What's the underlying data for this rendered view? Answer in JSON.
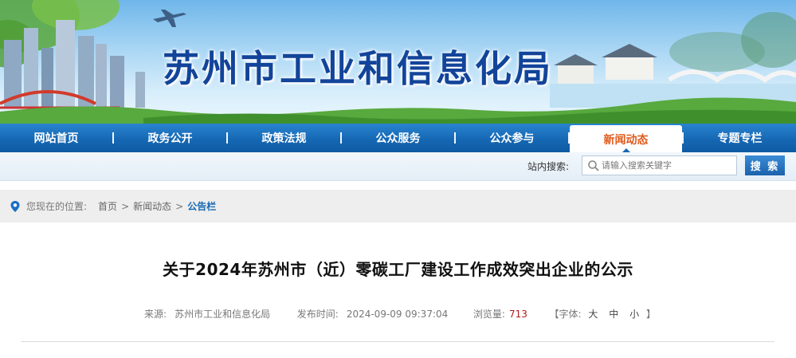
{
  "site": {
    "title": "苏州市工业和信息化局"
  },
  "nav": {
    "items": [
      {
        "label": "网站首页"
      },
      {
        "label": "政务公开"
      },
      {
        "label": "政策法规"
      },
      {
        "label": "公众服务"
      },
      {
        "label": "公众参与"
      },
      {
        "label": "新闻动态"
      },
      {
        "label": "专题专栏"
      }
    ],
    "active_index": 5,
    "active_color": "#e05a1b",
    "bar_color": "#1668b4"
  },
  "search": {
    "label": "站内搜索:",
    "placeholder": "请输入搜索关键字",
    "button": "搜 索"
  },
  "breadcrumb": {
    "prefix": "您现在的位置:",
    "items": [
      "首页",
      "新闻动态"
    ],
    "separator": ">",
    "current": "公告栏"
  },
  "article": {
    "title": "关于2024年苏州市（近）零碳工厂建设工作成效突出企业的公示",
    "source_label": "来源:",
    "source": "苏州市工业和信息化局",
    "date_label": "发布时间:",
    "date": "2024-09-09 09:37:04",
    "views_label": "浏览量:",
    "views": "713",
    "font_label": "【字体:",
    "font_large": "大",
    "font_medium": "中",
    "font_small": "小",
    "font_close": "】"
  }
}
